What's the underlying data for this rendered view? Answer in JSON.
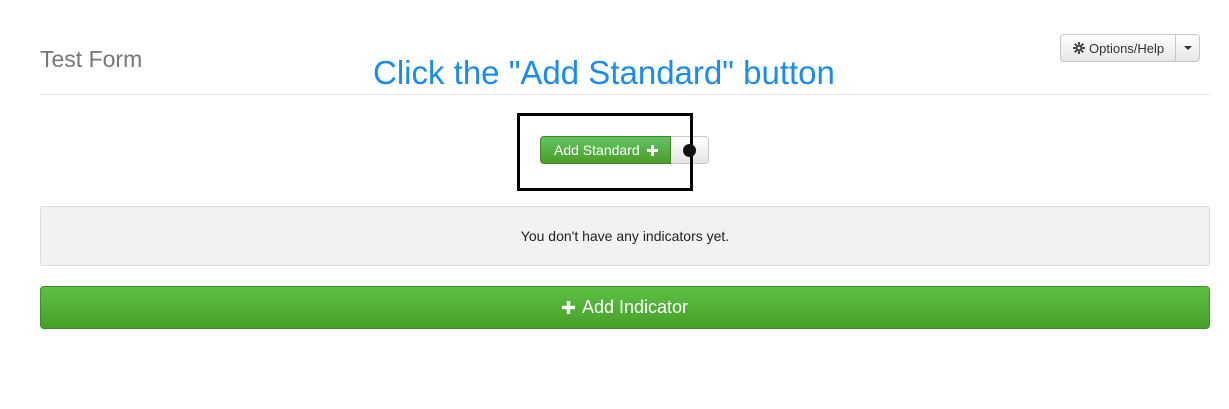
{
  "header": {
    "title": "Test Form",
    "options_label": "Options/Help",
    "options_icon": "gear-icon",
    "dropdown_icon": "caret-down-icon"
  },
  "instruction": "Click the \"Add Standard\" button",
  "standard": {
    "button_label": "Add Standard",
    "button_icon": "plus-icon"
  },
  "indicators": {
    "empty_message": "You don't have any indicators yet.",
    "add_label": "Add Indicator",
    "add_icon": "plus-icon"
  },
  "colors": {
    "accent_green": "#4c9d2a",
    "instruction_blue": "#1a8cf0",
    "highlight_border": "#000000"
  }
}
